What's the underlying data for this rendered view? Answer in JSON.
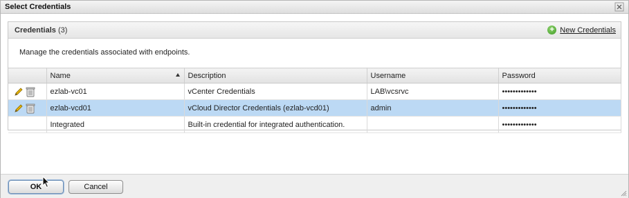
{
  "dialog": {
    "title": "Select Credentials"
  },
  "panel": {
    "title": "Credentials",
    "count": "(3)",
    "new_button_label": "New Credentials",
    "description": "Manage the credentials associated with endpoints."
  },
  "table": {
    "columns": [
      "Name",
      "Description",
      "Username",
      "Password"
    ],
    "rows": [
      {
        "name": "ezlab-vc01",
        "description": "vCenter Credentials",
        "username": "LAB\\vcsrvc",
        "password": "•••••••••••••",
        "editable": true,
        "selected": false
      },
      {
        "name": "ezlab-vcd01",
        "description": "vCloud Director Credentials (ezlab-vcd01)",
        "username": "admin",
        "password": "•••••••••••••",
        "editable": true,
        "selected": true
      },
      {
        "name": "Integrated",
        "description": "Built-in credential for integrated authentication.",
        "username": "",
        "password": "•••••••••••••",
        "editable": false,
        "selected": false
      }
    ]
  },
  "footer": {
    "ok_label": "OK",
    "cancel_label": "Cancel"
  },
  "colors": {
    "selected_row": "#bcd9f4",
    "add_icon": "#3d9a22",
    "pencil": "#e0a800"
  },
  "icons": {
    "close": "close-icon",
    "add": "plus-circle-icon",
    "edit": "pencil-icon",
    "delete": "trash-icon",
    "sort": "sort-ascending-icon",
    "resize": "resize-grip-icon"
  }
}
